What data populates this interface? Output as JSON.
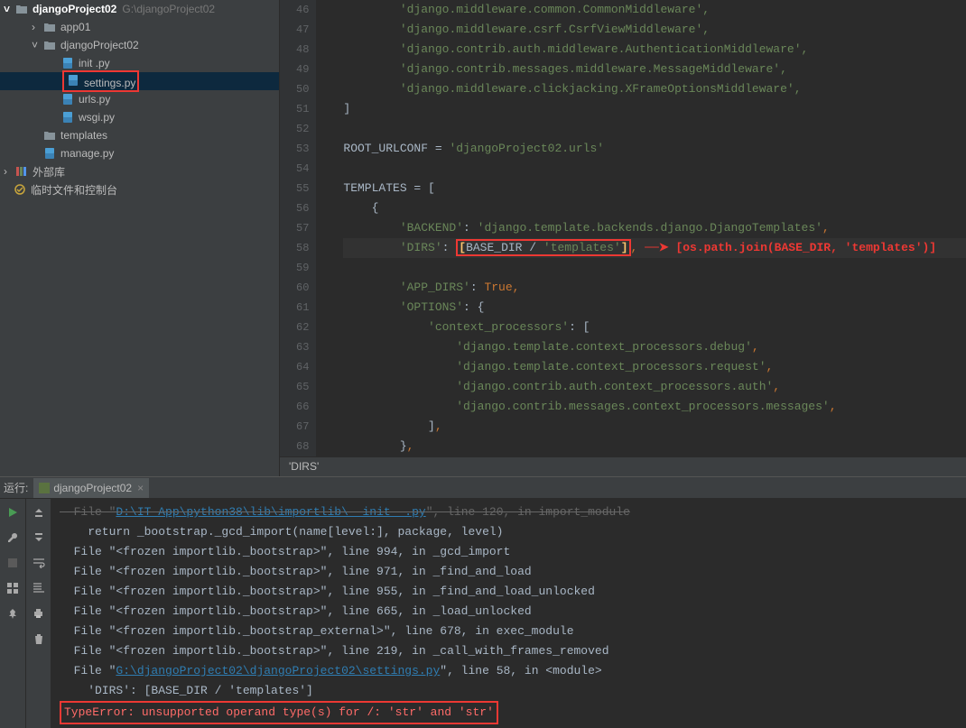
{
  "sidebar": {
    "root_name": "djangoProject02",
    "root_path": "G:\\djangoProject02",
    "items": [
      {
        "label": "app01",
        "indent": 35,
        "type": "folder",
        "chevron": ">"
      },
      {
        "label": "djangoProject02",
        "indent": 35,
        "type": "folder",
        "chevron": "v"
      },
      {
        "label": "init   .py",
        "indent": 55,
        "type": "py",
        "chevron": ""
      },
      {
        "label": "settings.py",
        "indent": 55,
        "type": "py",
        "chevron": "",
        "boxed": true,
        "selected": true
      },
      {
        "label": "urls.py",
        "indent": 55,
        "type": "py",
        "chevron": ""
      },
      {
        "label": "wsgi.py",
        "indent": 55,
        "type": "py",
        "chevron": ""
      },
      {
        "label": "templates",
        "indent": 35,
        "type": "folder",
        "chevron": ""
      },
      {
        "label": "manage.py",
        "indent": 35,
        "type": "py",
        "chevron": ""
      }
    ],
    "external_label": "外部库",
    "temp_label": "临时文件和控制台"
  },
  "editor": {
    "lines": [
      46,
      47,
      48,
      49,
      50,
      51,
      52,
      53,
      54,
      55,
      56,
      57,
      58,
      59,
      60,
      61,
      62,
      63,
      64,
      65,
      66,
      67,
      68
    ],
    "l46": "    'django.middleware.common.CommonMiddleware',",
    "l47": "    'django.middleware.csrf.CsrfViewMiddleware',",
    "l48": "    'django.contrib.auth.middleware.AuthenticationMiddleware',",
    "l49": "    'django.contrib.messages.middleware.MessageMiddleware',",
    "l50": "    'django.middleware.clickjacking.XFrameOptionsMiddleware',",
    "l51": "]",
    "l53_var": "ROOT_URLCONF",
    "l53_val": "'djangoProject02.urls'",
    "l55_var": "TEMPLATES",
    "l57_key": "'BACKEND'",
    "l57_val": "'django.template.backends.django.DjangoTemplates'",
    "l58_key": "'DIRS'",
    "l58_left": "[",
    "l58_mid1": "BASE_DIR",
    "l58_op": " / ",
    "l58_mid2": "'templates'",
    "l58_right": "]",
    "annotation": "[os.path.join(BASE_DIR, 'templates')]",
    "l60_key": "'APP_DIRS'",
    "l60_val": "True",
    "l61_key": "'OPTIONS'",
    "l62_key": "'context_processors'",
    "l63": "'django.template.context_processors.debug'",
    "l64": "'django.template.context_processors.request'",
    "l65": "'django.contrib.auth.context_processors.auth'",
    "l66": "'django.contrib.messages.context_processors.messages'",
    "breadcrumb": "'DIRS'"
  },
  "runbar": {
    "label": "运行:",
    "tab_name": "djangoProject02"
  },
  "console": {
    "l0a": "  File \"",
    "l0_link": "D:\\IT-App\\python38\\lib\\importlib\\__init__.py",
    "l0b": "\", line 120, in import_module",
    "l1": "    return _bootstrap._gcd_import(name[level:], package, level)",
    "l2": "  File \"<frozen importlib._bootstrap>\", line 994, in _gcd_import",
    "l3": "  File \"<frozen importlib._bootstrap>\", line 971, in _find_and_load",
    "l4": "  File \"<frozen importlib._bootstrap>\", line 955, in _find_and_load_unlocked",
    "l5": "  File \"<frozen importlib._bootstrap>\", line 665, in _load_unlocked",
    "l6": "  File \"<frozen importlib._bootstrap_external>\", line 678, in exec_module",
    "l7": "  File \"<frozen importlib._bootstrap>\", line 219, in _call_with_frames_removed",
    "l8a": "  File \"",
    "l8_link": "G:\\djangoProject02\\djangoProject02\\settings.py",
    "l8b": "\", line 58, in <module>",
    "l9": "    'DIRS': [BASE_DIR / 'templates']",
    "l10": "TypeError: unsupported operand type(s) for /: 'str' and 'str'"
  }
}
